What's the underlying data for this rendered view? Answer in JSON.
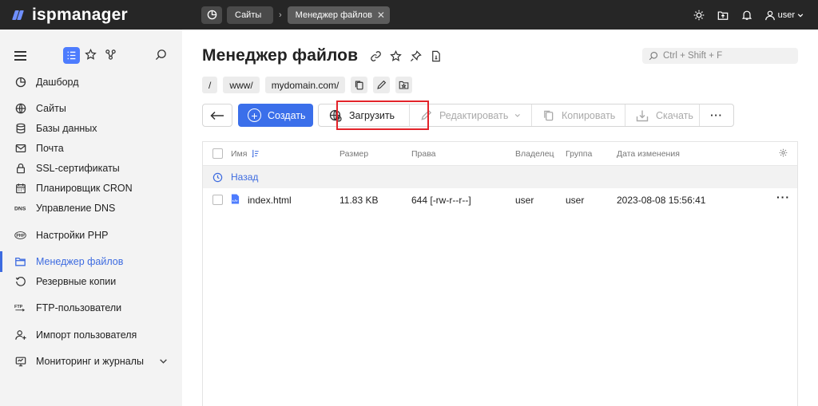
{
  "topbar": {
    "logo": "ispmanager",
    "breadcrumbs": [
      {
        "label": "Сайты"
      },
      {
        "label": "Менеджер файлов"
      }
    ],
    "user": "user"
  },
  "sidebar": {
    "items": [
      {
        "label": "Дашборд",
        "icon": "pie-chart-icon"
      },
      {
        "label": "Сайты",
        "icon": "globe-icon"
      },
      {
        "label": "Базы данных",
        "icon": "database-icon"
      },
      {
        "label": "Почта",
        "icon": "mail-icon"
      },
      {
        "label": "SSL-сертификаты",
        "icon": "lock-icon"
      },
      {
        "label": "Планировщик CRON",
        "icon": "calendar-icon"
      },
      {
        "label": "Управление DNS",
        "icon": "dns-icon"
      },
      {
        "label": "Настройки PHP",
        "icon": "php-icon"
      },
      {
        "label": "Менеджер файлов",
        "icon": "folder-icon",
        "active": true
      },
      {
        "label": "Резервные копии",
        "icon": "backup-icon"
      },
      {
        "label": "FTP-пользователи",
        "icon": "ftp-icon"
      },
      {
        "label": "Импорт пользователя",
        "icon": "user-import-icon"
      },
      {
        "label": "Мониторинг и журналы",
        "icon": "monitor-icon"
      }
    ]
  },
  "main": {
    "title": "Менеджер файлов",
    "search_placeholder": "Ctrl + Shift + F",
    "path": [
      "/",
      "www/",
      "mydomain.com/"
    ],
    "toolbar": {
      "create": "Создать",
      "upload": "Загрузить",
      "edit": "Редактировать",
      "copy": "Копировать",
      "download": "Скачать",
      "more": "···"
    },
    "table": {
      "columns": {
        "name": "Имя",
        "size": "Размер",
        "rights": "Права",
        "owner": "Владелец",
        "group": "Группа",
        "modified": "Дата изменения"
      },
      "back": "Назад",
      "rows": [
        {
          "name": "index.html",
          "size": "11.83 KB",
          "rights": "644 [-rw-r--r--]",
          "owner": "user",
          "group": "user",
          "modified": "2023-08-08 15:56:41"
        }
      ]
    }
  },
  "colors": {
    "topbar": "#262626",
    "accent": "#3b6fea",
    "highlight": "#e3232a"
  }
}
